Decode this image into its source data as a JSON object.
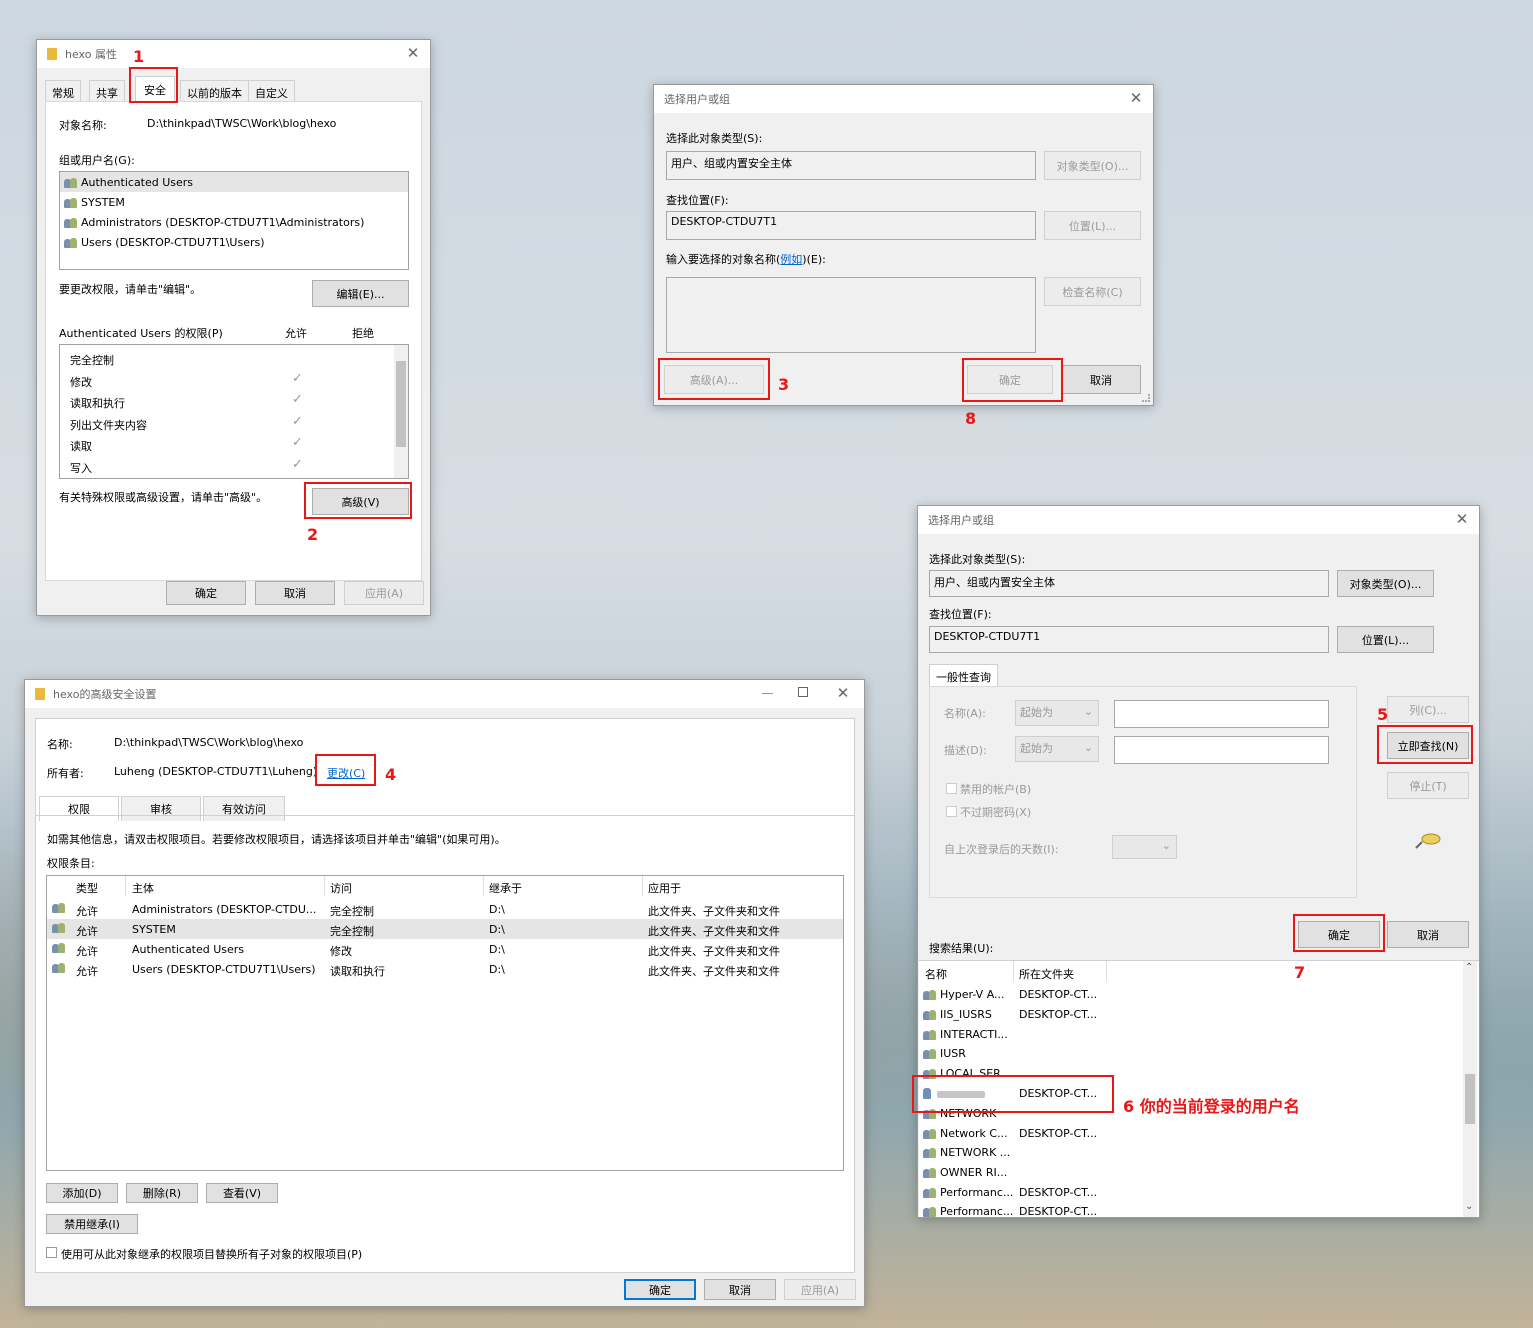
{
  "props": {
    "title": "hexo 属性",
    "tabs": [
      "常规",
      "共享",
      "安全",
      "以前的版本",
      "自定义"
    ],
    "object_label": "对象名称:",
    "object_value": "D:\\thinkpad\\TWSC\\Work\\blog\\hexo",
    "group_label": "组或用户名(G):",
    "groups": [
      "Authenticated Users",
      "SYSTEM",
      "Administrators (DESKTOP-CTDU7T1\\Administrators)",
      "Users (DESKTOP-CTDU7T1\\Users)"
    ],
    "edit_hint": "要更改权限，请单击\"编辑\"。",
    "edit_button": "编辑(E)...",
    "perm_label": "Authenticated Users 的权限(P)",
    "allow": "允许",
    "deny": "拒绝",
    "perms": [
      "完全控制",
      "修改",
      "读取和执行",
      "列出文件夹内容",
      "读取",
      "写入"
    ],
    "adv_hint": "有关特殊权限或高级设置，请单击\"高级\"。",
    "adv_button": "高级(V)",
    "ok": "确定",
    "cancel": "取消",
    "apply": "应用(A)"
  },
  "select1": {
    "title": "选择用户或组",
    "type_label": "选择此对象类型(S):",
    "type_value": "用户、组或内置安全主体",
    "type_button": "对象类型(O)...",
    "loc_label": "查找位置(F):",
    "loc_value": "DESKTOP-CTDU7T1",
    "loc_button": "位置(L)...",
    "enter_label_a": "输入要选择的对象名称(",
    "enter_link": "例如",
    "enter_label_b": ")(E):",
    "check_button": "检查名称(C)",
    "adv_button": "高级(A)...",
    "ok": "确定",
    "cancel": "取消"
  },
  "advanced": {
    "title": "hexo的高级安全设置",
    "name_label": "名称:",
    "name_value": "D:\\thinkpad\\TWSC\\Work\\blog\\hexo",
    "owner_label": "所有者:",
    "owner_value": "Luheng (DESKTOP-CTDU7T1\\Luheng)",
    "change_link": "更改(C)",
    "tabs": [
      "权限",
      "审核",
      "有效访问"
    ],
    "info": "如需其他信息，请双击权限项目。若要修改权限项目，请选择该项目并单击\"编辑\"(如果可用)。",
    "entries_label": "权限条目:",
    "columns": [
      "类型",
      "主体",
      "访问",
      "继承于",
      "应用于"
    ],
    "rows": [
      [
        "允许",
        "Administrators (DESKTOP-CTDU...",
        "完全控制",
        "D:\\",
        "此文件夹、子文件夹和文件"
      ],
      [
        "允许",
        "SYSTEM",
        "完全控制",
        "D:\\",
        "此文件夹、子文件夹和文件"
      ],
      [
        "允许",
        "Authenticated Users",
        "修改",
        "D:\\",
        "此文件夹、子文件夹和文件"
      ],
      [
        "允许",
        "Users (DESKTOP-CTDU7T1\\Users)",
        "读取和执行",
        "D:\\",
        "此文件夹、子文件夹和文件"
      ]
    ],
    "add_button": "添加(D)",
    "remove_button": "删除(R)",
    "view_button": "查看(V)",
    "disable_inherit": "禁用继承(I)",
    "replace_label": "使用可从此对象继承的权限项目替换所有子对象的权限项目(P)",
    "ok": "确定",
    "cancel": "取消",
    "apply": "应用(A)"
  },
  "select2": {
    "title": "选择用户或组",
    "type_label": "选择此对象类型(S):",
    "type_value": "用户、组或内置安全主体",
    "type_button": "对象类型(O)...",
    "loc_label": "查找位置(F):",
    "loc_value": "DESKTOP-CTDU7T1",
    "loc_button": "位置(L)...",
    "query_tab": "一般性查询",
    "name_label": "名称(A):",
    "desc_label": "描述(D):",
    "starts_with": "起始为",
    "disabled_acct": "禁用的帐户(B)",
    "no_expire": "不过期密码(X)",
    "days_label": "自上次登录后的天数(I):",
    "col_button": "列(C)...",
    "find_button": "立即查找(N)",
    "stop_button": "停止(T)",
    "ok": "确定",
    "cancel": "取消",
    "results_label": "搜索结果(U):",
    "result_cols": [
      "名称",
      "所在文件夹"
    ],
    "results": [
      [
        "Hyper-V A...",
        "DESKTOP-CT..."
      ],
      [
        "IIS_IUSRS",
        "DESKTOP-CT..."
      ],
      [
        "INTERACTI...",
        ""
      ],
      [
        "IUSR",
        ""
      ],
      [
        "LOCAL SER...",
        ""
      ],
      [
        "",
        "DESKTOP-CT..."
      ],
      [
        "NETWORK",
        ""
      ],
      [
        "Network C...",
        "DESKTOP-CT..."
      ],
      [
        "NETWORK ...",
        ""
      ],
      [
        "OWNER RI...",
        ""
      ],
      [
        "Performanc...",
        "DESKTOP-CT..."
      ],
      [
        "Performanc...",
        "DESKTOP-CT..."
      ]
    ]
  },
  "annotations": {
    "n1": "1",
    "n2": "2",
    "n3": "3",
    "n4": "4",
    "n5": "5",
    "n6": "6 你的当前登录的用户名",
    "n7": "7",
    "n8": "8"
  }
}
